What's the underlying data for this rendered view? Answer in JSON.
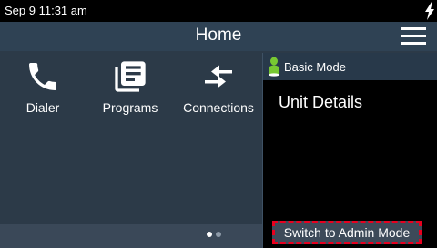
{
  "status_bar": {
    "datetime": "Sep 9 11:31 am",
    "charging_icon": "lightning-bolt-icon"
  },
  "header": {
    "title": "Home",
    "menu_icon": "hamburger-menu-icon"
  },
  "apps": [
    {
      "label": "Dialer",
      "icon": "phone-icon"
    },
    {
      "label": "Programs",
      "icon": "programs-list-icon"
    },
    {
      "label": "Connections",
      "icon": "connections-arrows-icon"
    }
  ],
  "pager": {
    "pages": 2,
    "current": 1
  },
  "panel": {
    "mode_label": "Basic Mode",
    "mode_icon": "user-mode-icon",
    "title": "Unit Details",
    "switch_button": "Switch to Admin Mode"
  },
  "colors": {
    "status_bar": "#000000",
    "header": "#2f4254",
    "background": "#2c3a48",
    "panel": "#000000",
    "highlight_dashed_border": "#e8001f",
    "mode_icon_green": "#78c832"
  }
}
